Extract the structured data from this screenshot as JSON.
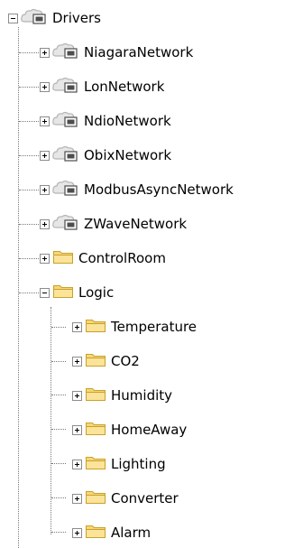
{
  "tree": {
    "root": {
      "label": "Drivers",
      "icon": "network-cloud-icon",
      "expanded": true
    },
    "networks": [
      {
        "label": "NiagaraNetwork",
        "icon": "network-cloud-icon",
        "expanded": false
      },
      {
        "label": "LonNetwork",
        "icon": "network-cloud-icon",
        "expanded": false
      },
      {
        "label": "NdioNetwork",
        "icon": "network-cloud-icon",
        "expanded": false
      },
      {
        "label": "ObixNetwork",
        "icon": "network-cloud-icon",
        "expanded": false
      },
      {
        "label": "ModbusAsyncNetwork",
        "icon": "network-cloud-icon",
        "expanded": false
      },
      {
        "label": "ZWaveNetwork",
        "icon": "network-cloud-icon",
        "expanded": false
      }
    ],
    "folders": [
      {
        "label": "ControlRoom",
        "icon": "folder-icon",
        "expanded": false
      },
      {
        "label": "Logic",
        "icon": "folder-icon",
        "expanded": true
      }
    ],
    "logic_children": [
      {
        "label": "Temperature",
        "icon": "folder-icon",
        "expanded": false
      },
      {
        "label": "CO2",
        "icon": "folder-icon",
        "expanded": false
      },
      {
        "label": "Humidity",
        "icon": "folder-icon",
        "expanded": false
      },
      {
        "label": "HomeAway",
        "icon": "folder-icon",
        "expanded": false
      },
      {
        "label": "Lighting",
        "icon": "folder-icon",
        "expanded": false
      },
      {
        "label": "Converter",
        "icon": "folder-icon",
        "expanded": false
      },
      {
        "label": "Alarm",
        "icon": "folder-icon",
        "expanded": false
      }
    ],
    "colors": {
      "folder_fill": "#f7d67a",
      "folder_edge": "#c9a227",
      "cloud": "#b5b5b5",
      "device": "#4d4d4d"
    }
  }
}
